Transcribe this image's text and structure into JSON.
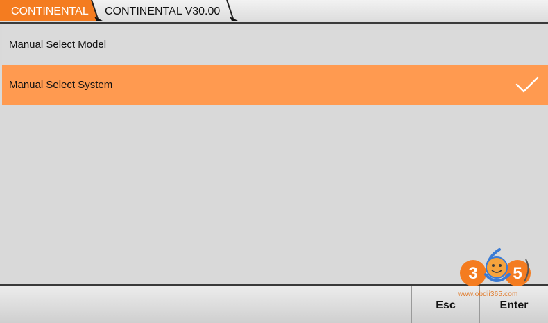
{
  "breadcrumb": {
    "items": [
      {
        "label": "CONTINENTAL"
      },
      {
        "label": "CONTINENTAL V30.00"
      }
    ]
  },
  "menu": {
    "items": [
      {
        "label": "Manual Select Model",
        "selected": false
      },
      {
        "label": "Manual Select System",
        "selected": true
      }
    ]
  },
  "toolbar": {
    "esc_label": "Esc",
    "enter_label": "Enter"
  },
  "watermark": {
    "logo_text": "365",
    "url": "www.obdii365.com"
  },
  "colors": {
    "accent": "#ff9a50",
    "active_crumb": "#f47c20",
    "background": "#d9d9d9"
  }
}
